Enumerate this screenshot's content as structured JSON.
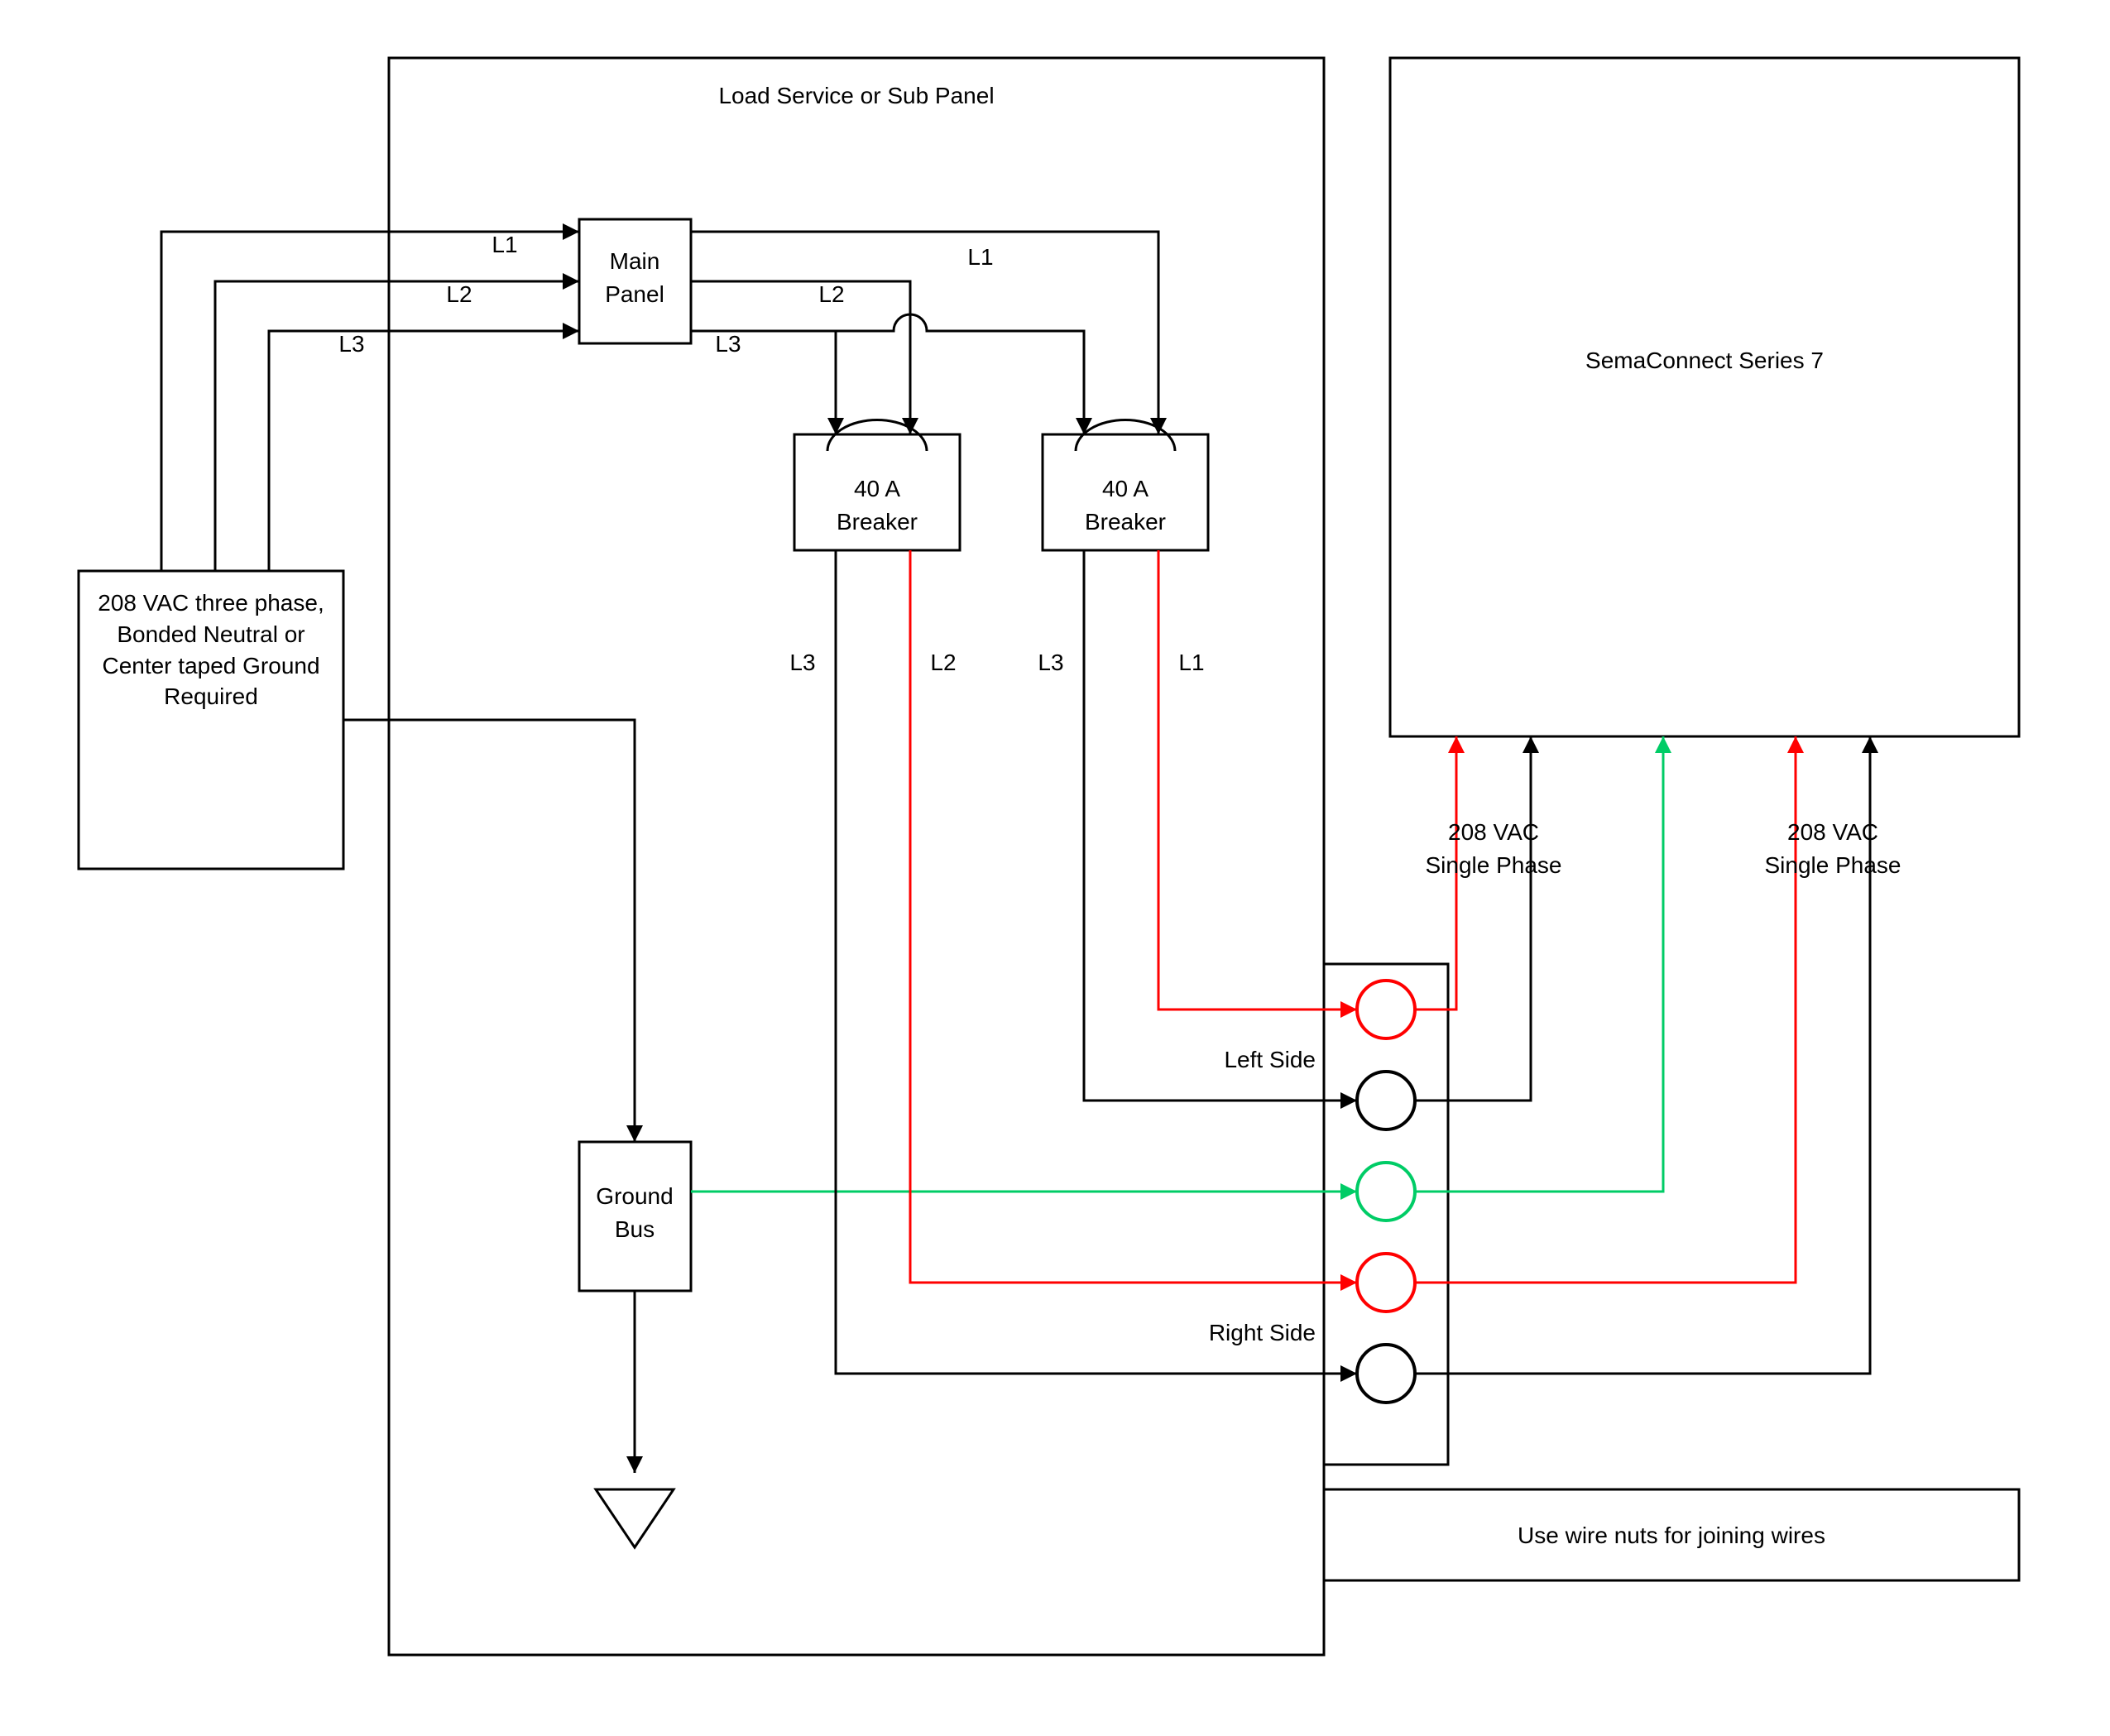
{
  "panel": {
    "title": "Load Service or Sub Panel",
    "main_panel": "Main Panel",
    "breaker_left": "40 A Breaker",
    "breaker_right": "40 A Breaker",
    "ground_bus": "Ground Bus",
    "left_side": "Left Side",
    "right_side": "Right Side",
    "wire_nuts_note": "Use wire nuts for joining wires"
  },
  "lines": {
    "L1": "L1",
    "L2": "L2",
    "L3": "L3"
  },
  "source": {
    "label": "208 VAC three phase, Bonded Neutral or Center taped Ground Required"
  },
  "device": {
    "label": "SemaConnect Series 7"
  },
  "labels": {
    "single_phase": "208 VAC Single Phase"
  },
  "colors": {
    "black": "#000000",
    "red": "#ff0000",
    "green": "#00cc66"
  }
}
